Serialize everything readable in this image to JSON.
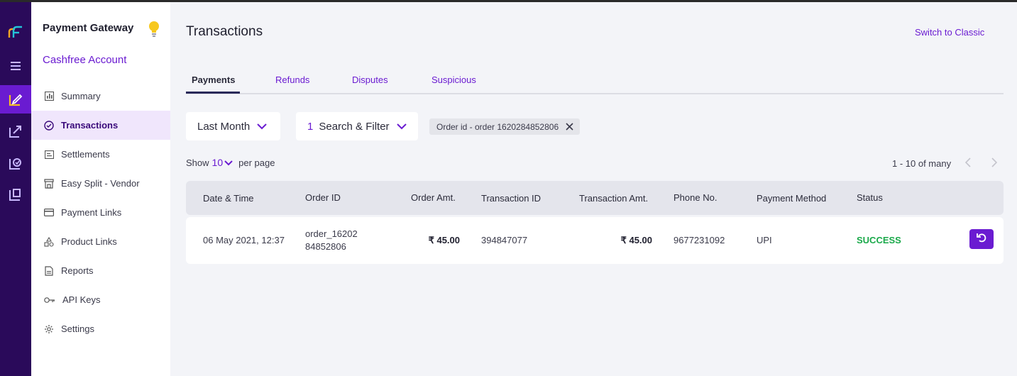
{
  "sidebar": {
    "title": "Payment Gateway",
    "account": "Cashfree Account",
    "items": [
      {
        "label": "Summary",
        "icon": "chart-bar-icon"
      },
      {
        "label": "Transactions",
        "icon": "transactions-icon"
      },
      {
        "label": "Settlements",
        "icon": "settlements-icon"
      },
      {
        "label": "Easy Split - Vendor",
        "icon": "store-icon"
      },
      {
        "label": "Payment Links",
        "icon": "card-icon"
      },
      {
        "label": "Product Links",
        "icon": "shapes-icon"
      },
      {
        "label": "Reports",
        "icon": "document-icon"
      },
      {
        "label": "API Keys",
        "icon": "key-icon"
      },
      {
        "label": "Settings",
        "icon": "gear-icon"
      }
    ]
  },
  "header": {
    "title": "Transactions",
    "switch_label": "Switch to Classic"
  },
  "tabs": [
    "Payments",
    "Refunds",
    "Disputes",
    "Suspicious"
  ],
  "filters": {
    "period": "Last Month",
    "filter_count": "1",
    "filter_label": "Search & Filter",
    "chip": "Order id - order 1620284852806"
  },
  "pagination": {
    "show": "Show",
    "per_page_value": "10",
    "per_page": "per page",
    "range": "1 - 10 of many"
  },
  "table": {
    "columns": [
      "Date & Time",
      "Order ID",
      "Order Amt.",
      "Transaction ID",
      "Transaction Amt.",
      "Phone No.",
      "Payment Method",
      "Status"
    ],
    "rows": [
      {
        "date": "06 May 2021, 12:37",
        "order_id_line1": "order_16202",
        "order_id_line2": "84852806",
        "order_amt": "₹ 45.00",
        "transaction_id": "394847077",
        "transaction_amt": "₹ 45.00",
        "phone": "9677231092",
        "method": "UPI",
        "status": "SUCCESS"
      }
    ]
  },
  "colors": {
    "accent": "#6a1bd1",
    "rail": "#2a0a5a",
    "success": "#1aa94a"
  }
}
